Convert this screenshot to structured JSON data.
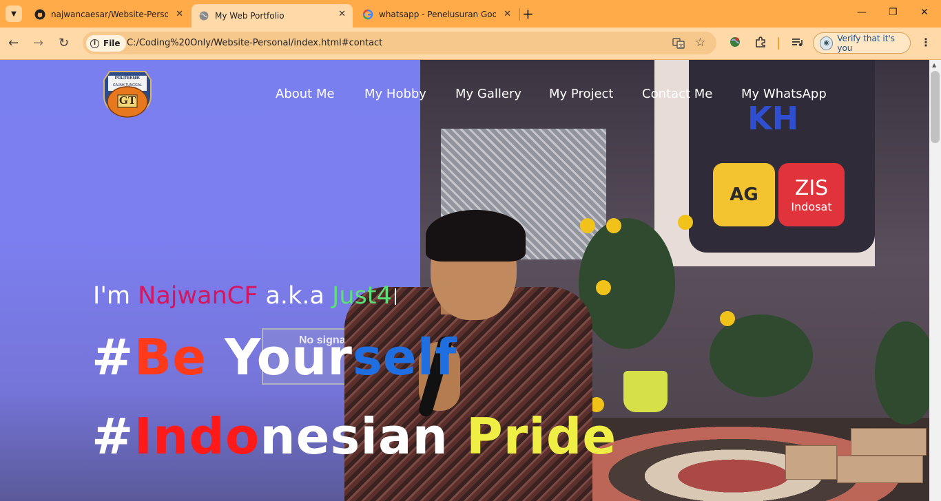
{
  "browser": {
    "tabs": [
      {
        "title": "najwancaesar/Website-Personal",
        "icon": "github-icon",
        "active": false
      },
      {
        "title": "My Web Portfolio",
        "icon": "globe-icon",
        "active": true
      },
      {
        "title": "whatsapp - Penelusuran Google",
        "icon": "google-icon",
        "active": false
      }
    ],
    "address": {
      "scheme_chip": "File",
      "url": "C:/Coding%20Only/Website-Personal/index.html#contact"
    },
    "profile_button": "Verify that it's you",
    "accent_color": "#ffab4a"
  },
  "page": {
    "nav": {
      "items": [
        "About Me",
        "My Hobby",
        "My Gallery",
        "My Project",
        "Contact Me",
        "My WhatsApp"
      ]
    },
    "logo": {
      "top_text": "POLITEKNIK",
      "bottom_text": "GAJAH TUNGGAL",
      "monogram": "GT"
    },
    "hero": {
      "intro_prefix": "I'm ",
      "name": "NajwanCF",
      "aka": " a.k.a ",
      "alias": "Just4",
      "line2": {
        "hash": "#",
        "be": "Be",
        "space": " ",
        "your": "Your",
        "self": "self"
      },
      "line3": {
        "hash": "#",
        "indo": "Indo",
        "nesian": "nesian",
        "space": " ",
        "pride": "Pride"
      }
    },
    "background_text": {
      "screen": "No signal",
      "sponsor_1": "AG",
      "sponsor_2": "ZIS",
      "sponsor_2_sub": "Indosat",
      "banner_logo": "KH"
    },
    "colors": {
      "be": "#ff3a1a",
      "self": "#1f6fe0",
      "indo": "#ff1a1a",
      "pride": "#eeee44",
      "name": "#d4155f",
      "alias": "#5be07a"
    }
  }
}
